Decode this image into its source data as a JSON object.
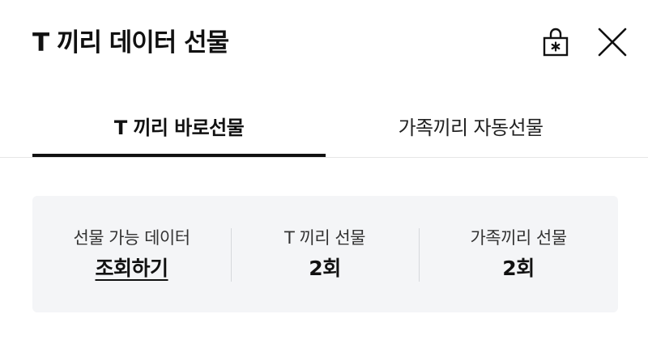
{
  "header": {
    "title": "T 끼리 데이터 선물",
    "lock_icon": "lock-icon",
    "close_icon": "close-icon"
  },
  "tabs": [
    {
      "label": "T 끼리 바로선물",
      "active": true
    },
    {
      "label": "가족끼리 자동선물",
      "active": false
    }
  ],
  "info": {
    "available": {
      "label": "선물 가능 데이터",
      "value": "조회하기"
    },
    "t_gift": {
      "label": "T 끼리 선물",
      "value": "2회"
    },
    "family_gift": {
      "label": "가족끼리 선물",
      "value": "2회"
    }
  },
  "colors": {
    "text": "#111111",
    "card_bg": "#f4f5f7",
    "tab_indicator": "#111111"
  }
}
